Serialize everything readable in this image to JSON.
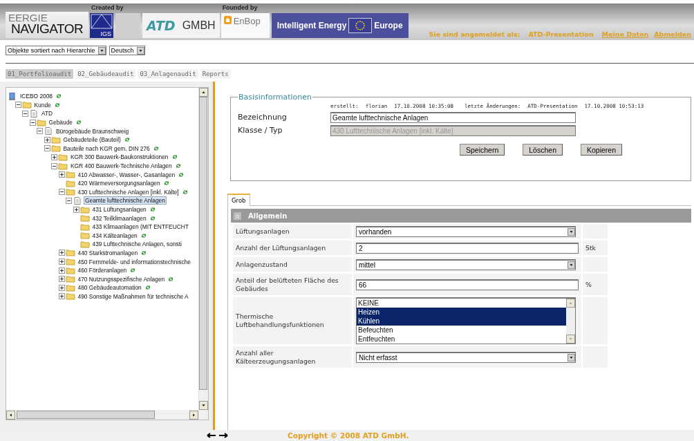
{
  "header": {
    "logo_top": "ERGIE",
    "logo_first": "E",
    "logo_initial": "N",
    "logo_rest": "AVIGATOR",
    "created_by": "Created by",
    "igs": "IGS",
    "atd": "ATD",
    "gmbh": "GMBH",
    "founded_by": "Founded by",
    "enbop": "EnBop",
    "ie_left": "Intelligent Energy",
    "ie_right": "Europe",
    "login_label": "Sie sind angemeldet als:",
    "login_user": "ATD-Presentation",
    "links": [
      "Meine Daten",
      "Abmelden"
    ]
  },
  "toolbar": {
    "selects": [
      "Objekte sortiert nach Hierarchie",
      "Deutsch"
    ]
  },
  "tabs": [
    {
      "label": "01_Portfolioaudit",
      "selected": true
    },
    {
      "label": "02_Gebäudeaudit",
      "selected": false
    },
    {
      "label": "03_Anlagenaudit",
      "selected": false
    },
    {
      "label": "Reports",
      "selected": false
    }
  ],
  "tree": [
    {
      "label": "ICEBO 2008",
      "kind": "root",
      "expandable": false,
      "synced": true,
      "selected": false,
      "children": [
        {
          "label": "Kunde",
          "kind": "folder",
          "expandable": true,
          "expanded": true,
          "synced": true,
          "selected": false,
          "children": [
            {
              "label": "ATD",
              "kind": "document",
              "expandable": true,
              "expanded": true,
              "synced": false,
              "selected": false,
              "children": [
                {
                  "label": "Gebäude",
                  "kind": "folder",
                  "expandable": true,
                  "expanded": true,
                  "synced": true,
                  "selected": false,
                  "children": [
                    {
                      "label": "Bürogebäude Braunschweig",
                      "kind": "document",
                      "expandable": true,
                      "expanded": true,
                      "synced": false,
                      "selected": false,
                      "children": [
                        {
                          "label": "Gebäudeteile (Bauteil)",
                          "kind": "folder",
                          "expandable": true,
                          "expanded": false,
                          "synced": true,
                          "selected": false
                        },
                        {
                          "label": "Bauteile nach KGR gem. DIN 276",
                          "kind": "folder",
                          "expandable": true,
                          "expanded": true,
                          "synced": true,
                          "selected": false,
                          "children": [
                            {
                              "label": "KGR 300 Bauwerk-Baukonstruktionen",
                              "kind": "folder",
                              "expandable": true,
                              "expanded": false,
                              "synced": true,
                              "selected": false
                            },
                            {
                              "label": "KGR 400 Bauwerk-Technische Anlagen",
                              "kind": "folder",
                              "expandable": true,
                              "expanded": true,
                              "synced": true,
                              "selected": false,
                              "children": [
                                {
                                  "label": "410 Abwasser-, Wasser-, Gasanlagen",
                                  "kind": "folder",
                                  "expandable": true,
                                  "expanded": false,
                                  "synced": true,
                                  "selected": false
                                },
                                {
                                  "label": "420 Wärmeversorgungsanlagen",
                                  "kind": "folder",
                                  "expandable": false,
                                  "synced": true,
                                  "selected": false
                                },
                                {
                                  "label": "430 Lufttechnische Anlagen [inkl. Kälte]",
                                  "kind": "folder",
                                  "expandable": true,
                                  "expanded": true,
                                  "synced": true,
                                  "selected": false,
                                  "children": [
                                    {
                                      "label": "Geamte lufttechnische Anlagen",
                                      "kind": "document",
                                      "expandable": true,
                                      "expanded": true,
                                      "synced": false,
                                      "selected": true,
                                      "children": [
                                        {
                                          "label": "431 Lüftungsanlagen",
                                          "kind": "folder",
                                          "expandable": true,
                                          "expanded": false,
                                          "synced": true,
                                          "selected": false
                                        },
                                        {
                                          "label": "432 Teilklimaanlagen",
                                          "kind": "folder",
                                          "expandable": false,
                                          "synced": true,
                                          "selected": false
                                        },
                                        {
                                          "label": "433 Klimaanlagen (MIT ENTFEUCHT",
                                          "kind": "folder",
                                          "expandable": false,
                                          "synced": false,
                                          "selected": false
                                        },
                                        {
                                          "label": "434 Kälteanlagen",
                                          "kind": "folder",
                                          "expandable": false,
                                          "synced": true,
                                          "selected": false
                                        },
                                        {
                                          "label": "439 Lufttechnische Anlagen, sonsti",
                                          "kind": "folder",
                                          "expandable": false,
                                          "synced": false,
                                          "selected": false
                                        }
                                      ]
                                    }
                                  ]
                                },
                                {
                                  "label": "440 Starkstromanlagen",
                                  "kind": "folder",
                                  "expandable": true,
                                  "expanded": false,
                                  "synced": true,
                                  "selected": false
                                },
                                {
                                  "label": "450 Fernmelde- und informationstechnische",
                                  "kind": "folder",
                                  "expandable": true,
                                  "expanded": false,
                                  "synced": false,
                                  "selected": false
                                },
                                {
                                  "label": "460 Förderanlagen",
                                  "kind": "folder",
                                  "expandable": true,
                                  "expanded": false,
                                  "synced": true,
                                  "selected": false
                                },
                                {
                                  "label": "470 Nutzungsspezifische Anlagen",
                                  "kind": "folder",
                                  "expandable": true,
                                  "expanded": false,
                                  "synced": true,
                                  "selected": false
                                },
                                {
                                  "label": "480 Gebäudeautomation",
                                  "kind": "folder",
                                  "expandable": true,
                                  "expanded": false,
                                  "synced": true,
                                  "selected": false
                                },
                                {
                                  "label": "490 Sonstige Maßnahmen für technische A",
                                  "kind": "folder",
                                  "expandable": true,
                                  "expanded": false,
                                  "synced": false,
                                  "selected": false
                                }
                              ]
                            }
                          ]
                        }
                      ]
                    }
                  ]
                }
              ]
            }
          ]
        }
      ]
    }
  ],
  "basis": {
    "legend": "Basisinformationen",
    "meta": [
      "erstellt:",
      "florian",
      "17.10.2008 10:35:08",
      "letzte Änderungen:",
      "ATD-Presentation",
      "17.10.2008 10:53:13"
    ],
    "fields": [
      {
        "label": "Bezeichnung",
        "value": "Geamte lufttechnische Anlagen",
        "disabled": false
      },
      {
        "label": "Klasse / Typ",
        "value": "430 Lufttechnische Anlagen [inkl. Kälte]",
        "disabled": true
      }
    ],
    "buttons": [
      "Speichern",
      "Löschen",
      "Kopieren"
    ]
  },
  "detail_tabs": [
    {
      "label": "Grob",
      "selected": true
    }
  ],
  "section": {
    "title": "Allgemein",
    "expanded": true,
    "rows": [
      {
        "kind": "select",
        "label": "Lüftungsanlagen",
        "value": "vorhanden"
      },
      {
        "kind": "input",
        "label": "Anzahl der Lüftungsanlagen",
        "value": "2",
        "unit": "Stk"
      },
      {
        "kind": "select",
        "label": "Anlagenzustand",
        "value": "mittel"
      },
      {
        "kind": "input",
        "label": "Anteil der belüfteten Fläche des Gebäudes",
        "value": "66",
        "unit": "%"
      },
      {
        "kind": "listbox",
        "label": "Thermische Luftbehandlungsfunktionen",
        "options": [
          {
            "label": "KEINE",
            "selected": false
          },
          {
            "label": "Heizen",
            "selected": true
          },
          {
            "label": "Kühlen",
            "selected": true
          },
          {
            "label": "Befeuchten",
            "selected": false
          },
          {
            "label": "Entfeuchten",
            "selected": false
          }
        ]
      },
      {
        "kind": "select",
        "label": "Anzahl aller Kälteerzeugungsanlagen",
        "value": "Nicht erfasst"
      }
    ]
  },
  "footer": {
    "copyright": "Copyright © 2008 ATD GmbH."
  }
}
